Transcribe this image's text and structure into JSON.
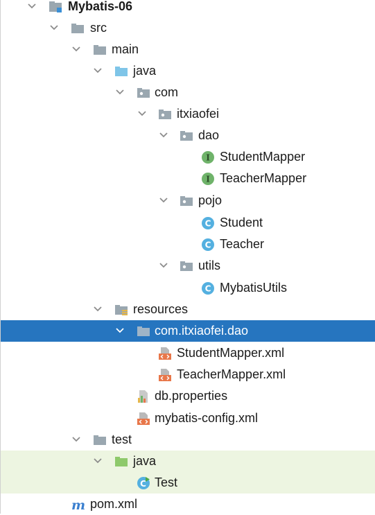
{
  "colors": {
    "selection": "#2675bf",
    "test_highlight": "#edf5e1",
    "folder_gray": "#9aa7b0",
    "source_folder_blue": "#7fc5e8",
    "test_folder_green": "#8ec96b",
    "interface_green": "#6fb36a",
    "class_blue": "#54b0e0",
    "xml_orange": "#e8774a"
  },
  "tree": {
    "project": {
      "label": "Mybatis-06",
      "icon": "project-module-icon"
    },
    "src": {
      "label": "src",
      "icon": "folder-icon"
    },
    "main": {
      "label": "main",
      "icon": "folder-icon"
    },
    "main_java": {
      "label": "java",
      "icon": "source-folder-icon"
    },
    "com": {
      "label": "com",
      "icon": "package-icon"
    },
    "itxiaofei": {
      "label": "itxiaofei",
      "icon": "package-icon"
    },
    "dao": {
      "label": "dao",
      "icon": "package-icon"
    },
    "student_mapper": {
      "label": "StudentMapper",
      "icon": "interface-icon",
      "badge": "I"
    },
    "teacher_mapper": {
      "label": "TeacherMapper",
      "icon": "interface-icon",
      "badge": "I"
    },
    "pojo": {
      "label": "pojo",
      "icon": "package-icon"
    },
    "student": {
      "label": "Student",
      "icon": "class-icon",
      "badge": "C"
    },
    "teacher": {
      "label": "Teacher",
      "icon": "class-icon",
      "badge": "C"
    },
    "utils": {
      "label": "utils",
      "icon": "package-icon"
    },
    "mybatis_utils": {
      "label": "MybatisUtils",
      "icon": "class-icon",
      "badge": "C"
    },
    "resources": {
      "label": "resources",
      "icon": "resources-folder-icon"
    },
    "res_package": {
      "label": "com.itxiaofei.dao",
      "icon": "folder-icon",
      "selected": true
    },
    "student_mapper_xml": {
      "label": "StudentMapper.xml",
      "icon": "xml-file-icon"
    },
    "teacher_mapper_xml": {
      "label": "TeacherMapper.xml",
      "icon": "xml-file-icon"
    },
    "db_properties": {
      "label": "db.properties",
      "icon": "properties-file-icon"
    },
    "mybatis_config": {
      "label": "mybatis-config.xml",
      "icon": "xml-file-icon"
    },
    "test": {
      "label": "test",
      "icon": "folder-icon"
    },
    "test_java": {
      "label": "java",
      "icon": "test-source-folder-icon"
    },
    "test_class": {
      "label": "Test",
      "icon": "test-class-icon",
      "badge": "C"
    },
    "pom": {
      "label": "pom.xml",
      "icon": "maven-pom-icon",
      "badge": "m"
    }
  }
}
